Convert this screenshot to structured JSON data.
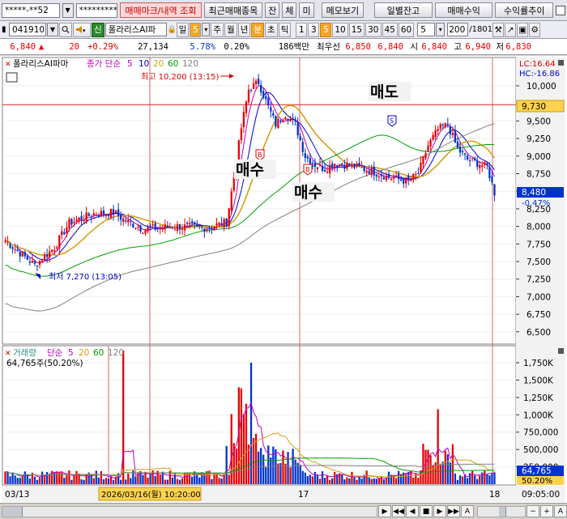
{
  "toolbar1": {
    "account": "*****-**52",
    "password": "*********",
    "buttons": [
      "매매마크/내역 조회",
      "최근매매종목",
      "잔",
      "체",
      "미",
      "메모보기",
      "일별잔고",
      "매매수익",
      "수익률추이"
    ]
  },
  "toolbar2": {
    "code": "041910",
    "market_badge": "신",
    "name": "폴라리스AI파",
    "periods": [
      "일",
      "5",
      "주",
      "월",
      "년",
      "분",
      "초",
      "틱"
    ],
    "selected_period": "분",
    "minutes": [
      "1",
      "3",
      "5",
      "10",
      "15",
      "30",
      "45",
      "60"
    ],
    "selected_minute": "5",
    "interval_value": "5",
    "count": "200",
    "total": "/1801"
  },
  "quote": {
    "price": "6,840",
    "arrow": "▲",
    "change": "20",
    "rate": "+0.29%",
    "volume": "27,134",
    "turnover_rate": "5.78%",
    "ratio": "0.20%",
    "amount": "186백만",
    "priority_label": "최우선",
    "best_ask": "6,850",
    "best_bid": "6,840",
    "open_label": "시",
    "open": "6,840",
    "high_label": "고",
    "high": "6,940",
    "low_label": "저",
    "low": "6,830"
  },
  "price_panel": {
    "title": "폴라리스AI파마",
    "ma_label": "종가 단순",
    "ma_periods": [
      "5",
      "10",
      "20",
      "60",
      "120"
    ],
    "lc": "LC:16.64",
    "hc": "HC:-16.86",
    "high_annotation": "최고 10,200 (13:15)",
    "low_annotation": "최저 7,270 (13:05)",
    "current_price_tag": "8,480",
    "current_rate_tag": "-0.47%",
    "ref_line_tag": "9,730",
    "y_ticks": [
      "10,000",
      "9,750",
      "9,500",
      "9,250",
      "9,000",
      "8,750",
      "8,500",
      "8,250",
      "8,000",
      "7,750",
      "7,500",
      "7,250",
      "7,000",
      "6,750",
      "6,500"
    ],
    "signals": [
      {
        "text": "매수",
        "badge": "B"
      },
      {
        "text": "매수",
        "badge": "B"
      },
      {
        "text": "매도",
        "badge": "S"
      }
    ]
  },
  "volume_panel": {
    "title": "거래량",
    "ma_label": "단순",
    "ma_periods": [
      "5",
      "20",
      "60",
      "120"
    ],
    "current_volume": "64,765주(50.20%)",
    "y_ticks": [
      "1,750K",
      "1,500K",
      "1,250K",
      "1,000K",
      "750,000",
      "500,000",
      "250,000"
    ],
    "volume_tag": "64,765",
    "rate_tag": "50.20%"
  },
  "x_axis": {
    "labels": [
      "03/13",
      "17",
      "18"
    ],
    "cursor_label": "2026/03/16(월) 10:20:00",
    "time_right": "09:05:00"
  },
  "bottom": {
    "nav_buttons": [
      "▶",
      "◀◀",
      "◀",
      "■",
      "▶",
      "▶▶",
      "A"
    ],
    "zoom": [
      "−",
      "+",
      "A"
    ]
  },
  "colors": {
    "up": "#e60000",
    "down": "#0033cc",
    "ma5": "#c000c0",
    "ma10": "#0000cc",
    "ma20": "#d4a017",
    "ma60": "#00a000",
    "ma120": "#808080",
    "ref_line": "#e03030"
  }
}
